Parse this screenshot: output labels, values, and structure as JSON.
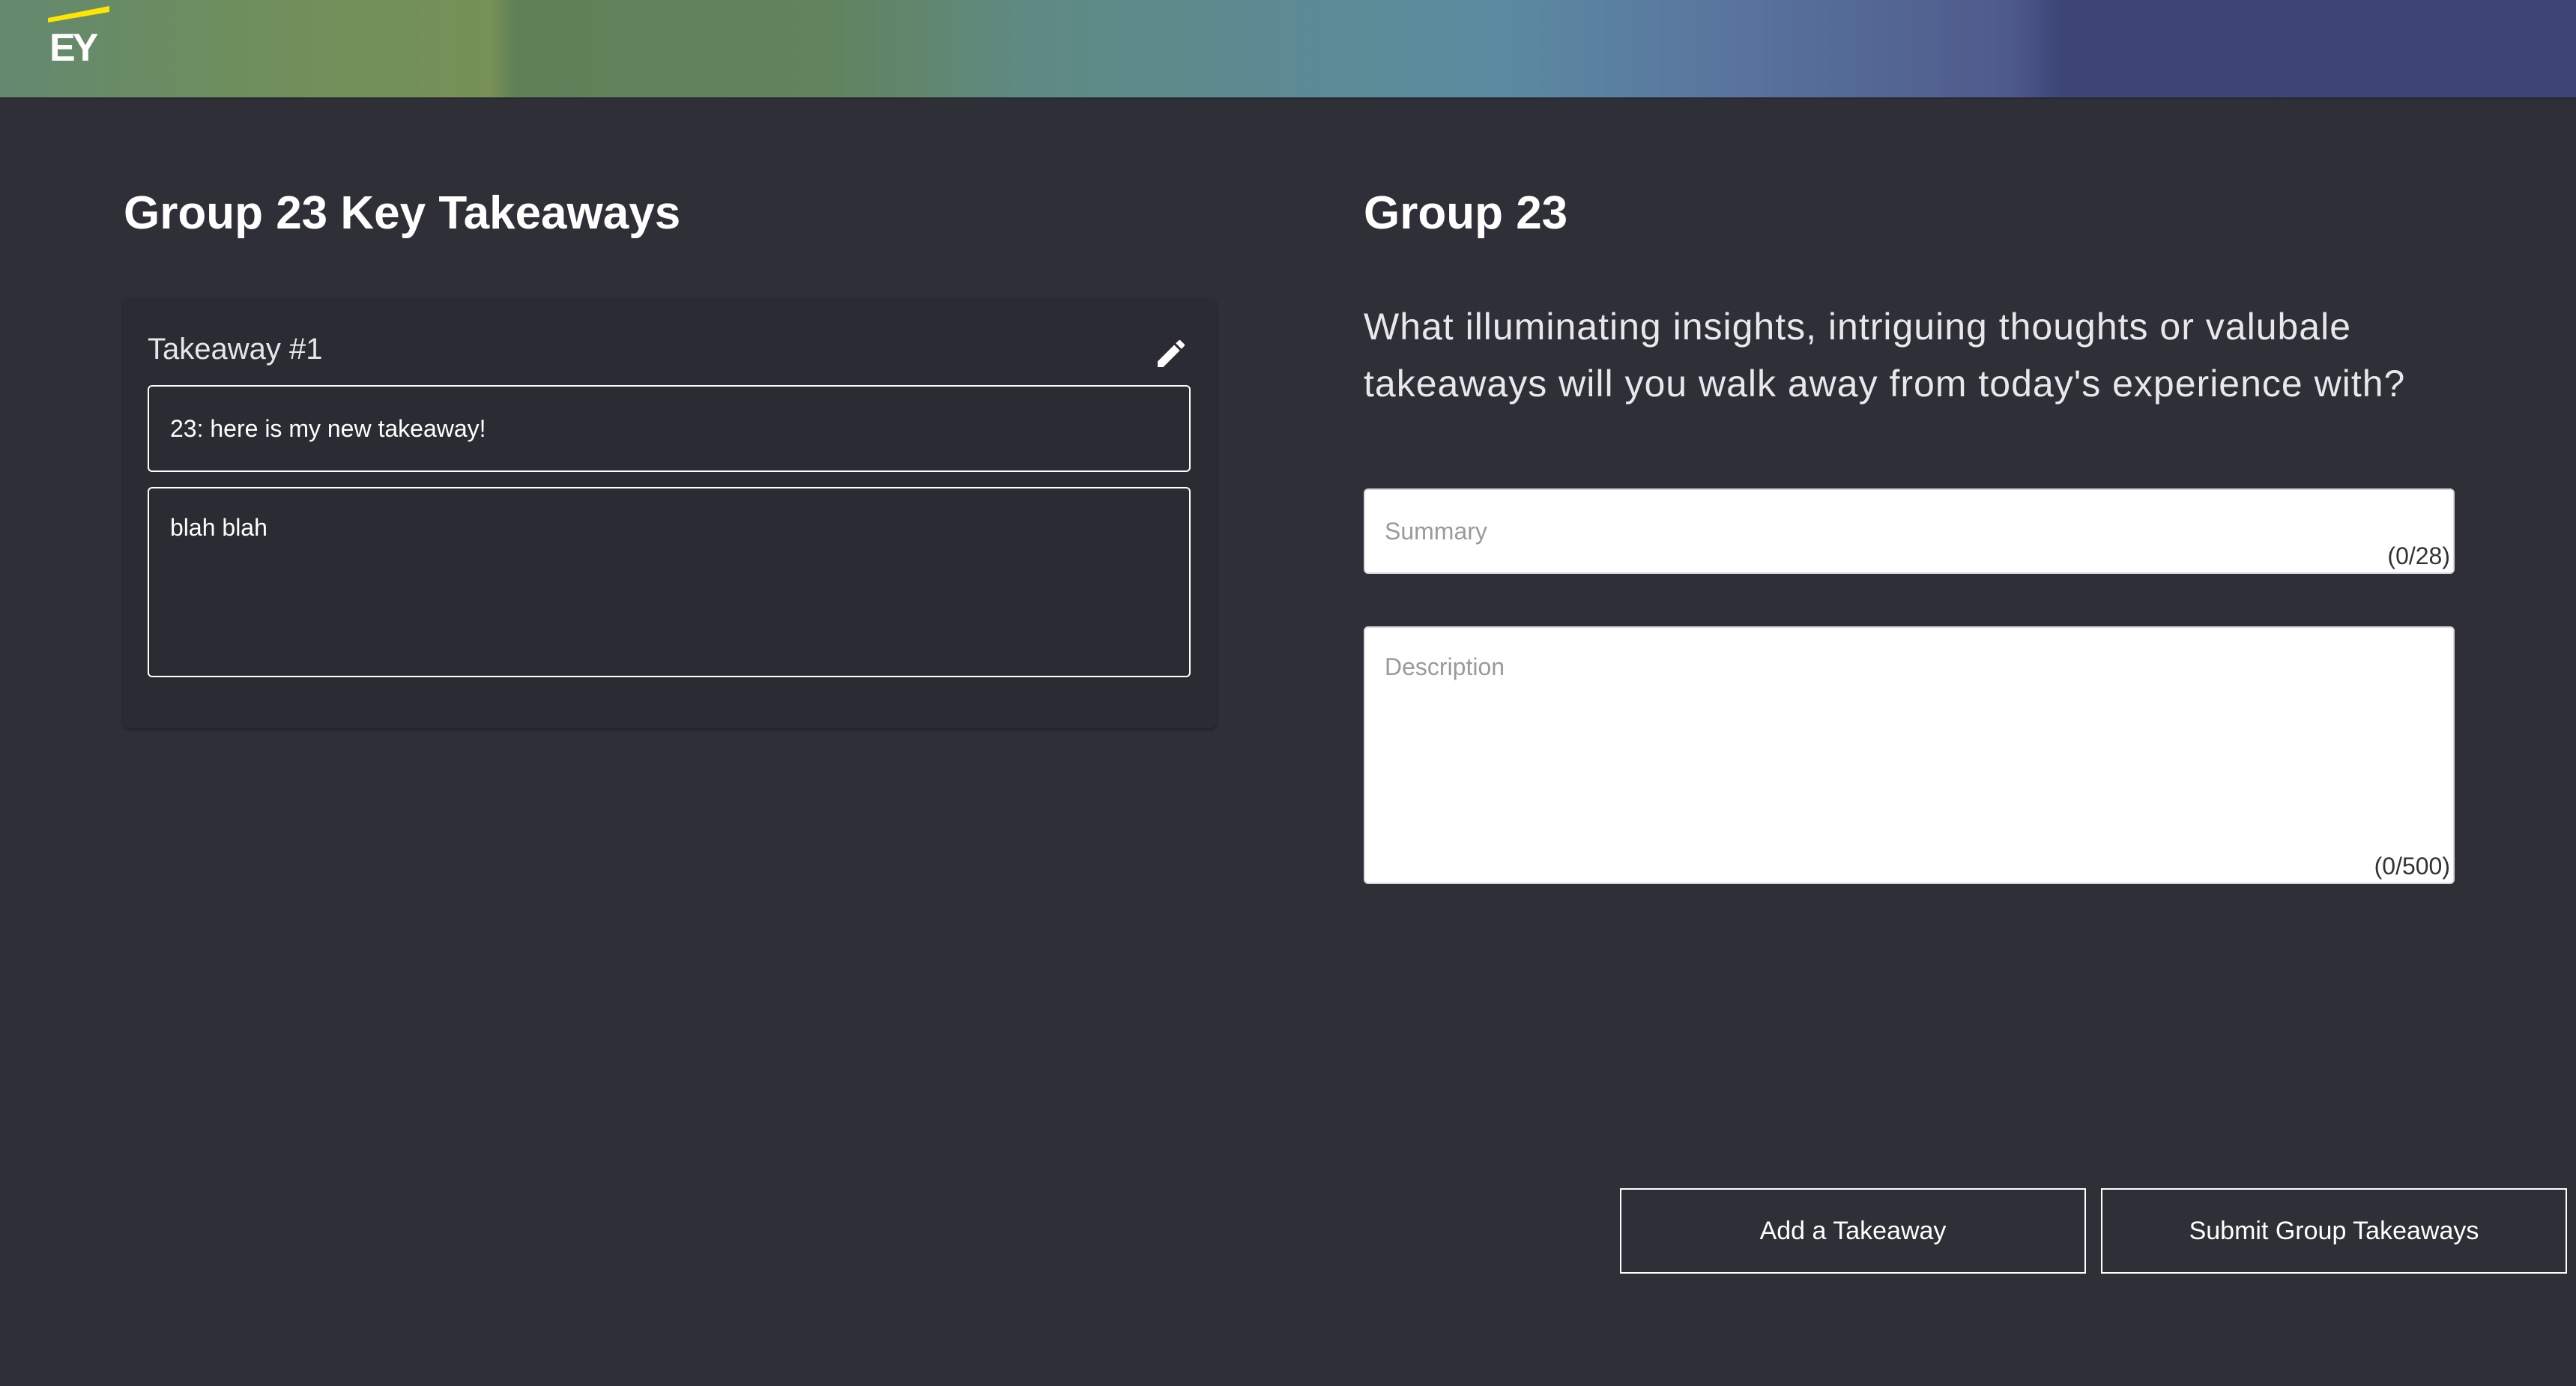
{
  "header": {
    "logo_text": "EY",
    "colors": {
      "logo_accent": "#ffe600"
    }
  },
  "left": {
    "title": "Group 23 Key Takeaways",
    "takeaways": [
      {
        "label": "Takeaway #1",
        "summary": "23: here is my new takeaway!",
        "description": "blah blah",
        "edit_icon": "pencil-icon"
      }
    ]
  },
  "right": {
    "title": "Group 23",
    "prompt": "What illuminating insights, intriguing thoughts or valubale takeaways will you walk away from today's experience with?",
    "summary": {
      "placeholder": "Summary",
      "value": "",
      "counter": "(0/28)"
    },
    "description": {
      "placeholder": "Description",
      "value": "",
      "counter": "(0/500)"
    }
  },
  "actions": {
    "add_label": "Add a Takeaway",
    "submit_label": "Submit Group Takeaways"
  },
  "colors": {
    "background": "#2e2f37",
    "card": "#2b2c33",
    "text": "#ffffff"
  }
}
